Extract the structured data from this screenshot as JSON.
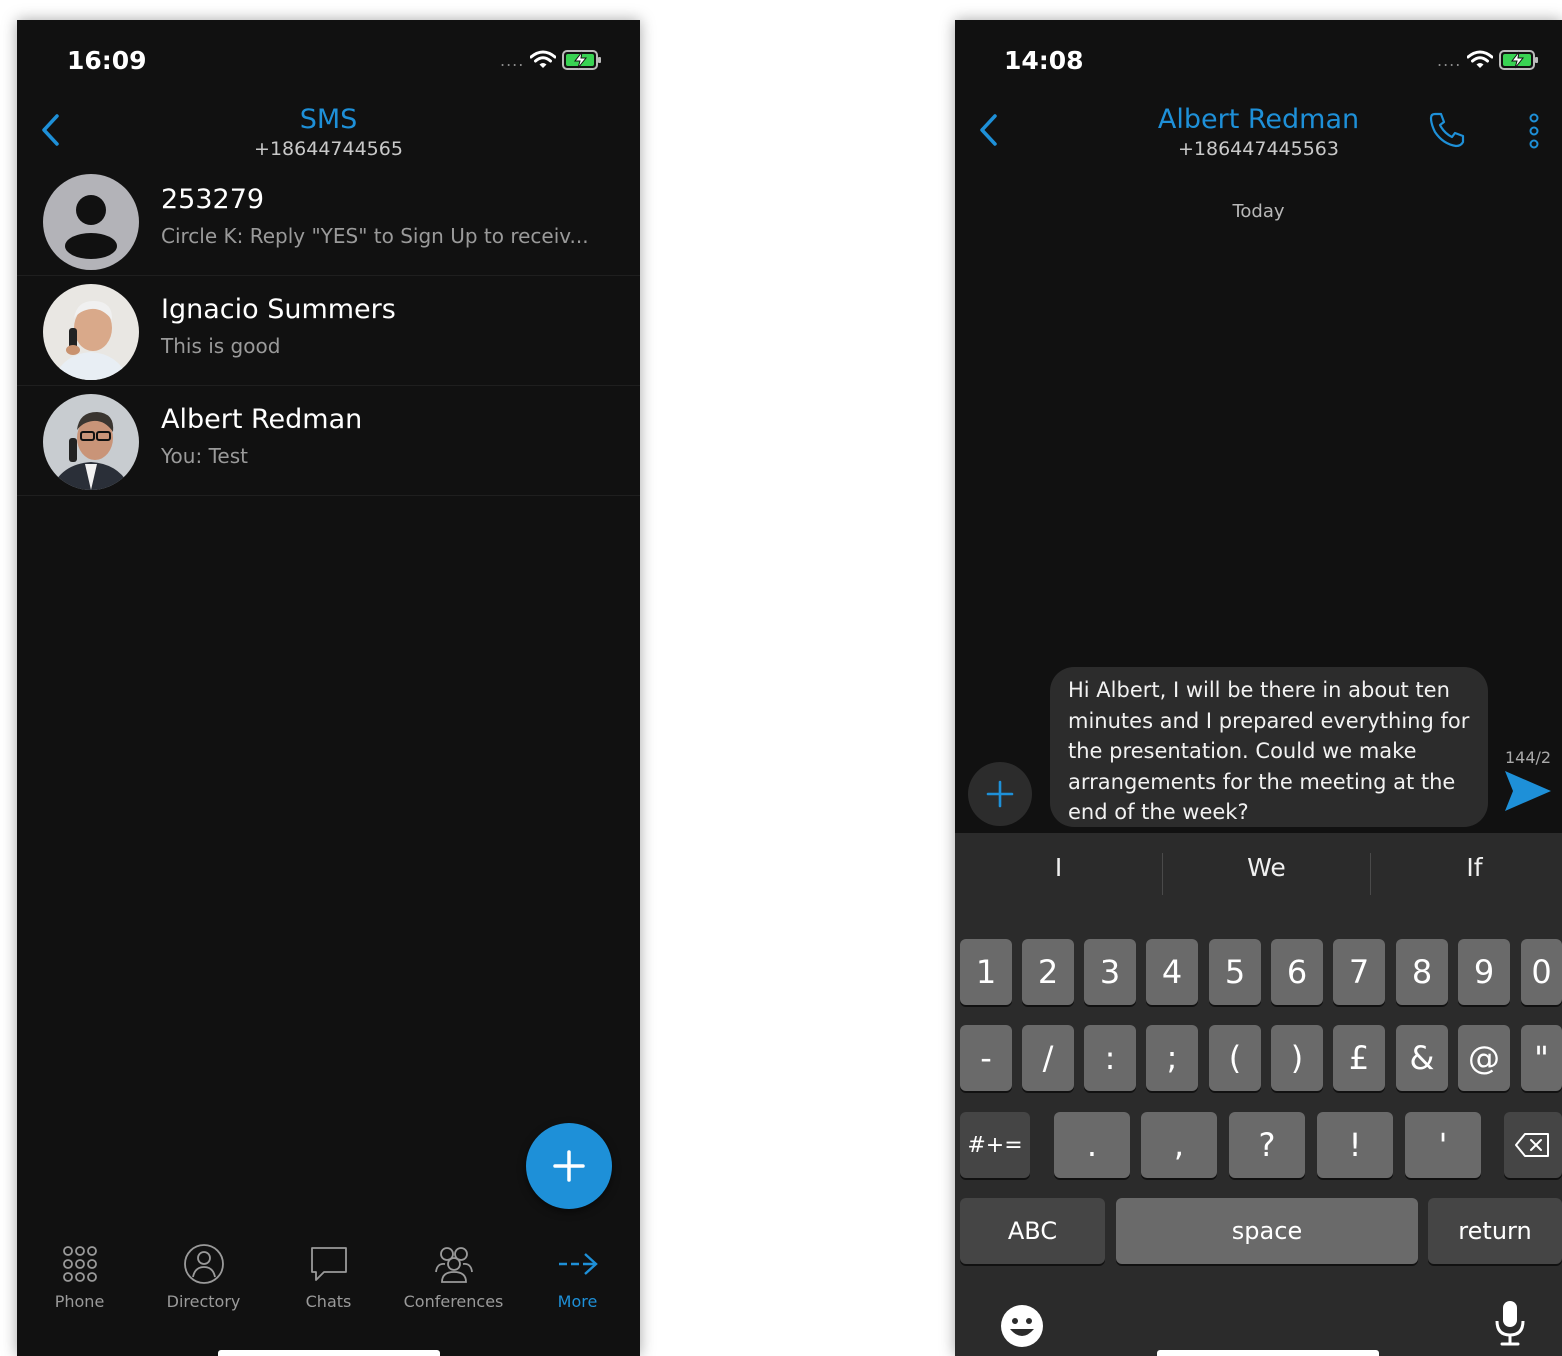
{
  "left": {
    "status_time": "16:09",
    "status_dots": "....",
    "header": {
      "title": "SMS",
      "subtitle": "+18644744565"
    },
    "conversations": [
      {
        "name": "253279",
        "preview": "Circle K: Reply \"YES\" to Sign Up to receiv...",
        "avatar": "default-avatar-icon"
      },
      {
        "name": "Ignacio Summers",
        "preview": "This is good",
        "avatar": "contact-photo"
      },
      {
        "name": "Albert Redman",
        "preview": "You: Test",
        "avatar": "contact-photo"
      }
    ],
    "tabs": [
      {
        "label": "Phone",
        "icon": "dialpad-icon"
      },
      {
        "label": "Directory",
        "icon": "person-icon"
      },
      {
        "label": "Chats",
        "icon": "chat-bubble-icon"
      },
      {
        "label": "Conferences",
        "icon": "group-icon"
      },
      {
        "label": "More",
        "icon": "arrow-right-icon"
      }
    ],
    "active_tab": "More"
  },
  "right": {
    "status_time": "14:08",
    "status_dots": "....",
    "header": {
      "title": "Albert Redman",
      "subtitle": "+186447445563"
    },
    "date_separator": "Today",
    "compose_text": "Hi Albert, I will be there in about ten minutes and I prepared everything for the presentation. Could we make arrangements for the meeting at the end of the week?",
    "char_count": "144/2",
    "keyboard": {
      "suggestions": [
        "I",
        "We",
        "If"
      ],
      "row1": [
        "1",
        "2",
        "3",
        "4",
        "5",
        "6",
        "7",
        "8",
        "9",
        "0"
      ],
      "row2": [
        "-",
        "/",
        ":",
        ";",
        "(",
        ")",
        "£",
        "&",
        "@",
        "\""
      ],
      "row3_left": "#+=",
      "row3": [
        ".",
        ",",
        "?",
        "!",
        "'"
      ],
      "abc": "ABC",
      "space": "space",
      "return": "return"
    }
  },
  "colors": {
    "accent": "#1e90d8",
    "background": "#111111",
    "key": "#6a6a6a",
    "key_fn": "#454545"
  }
}
